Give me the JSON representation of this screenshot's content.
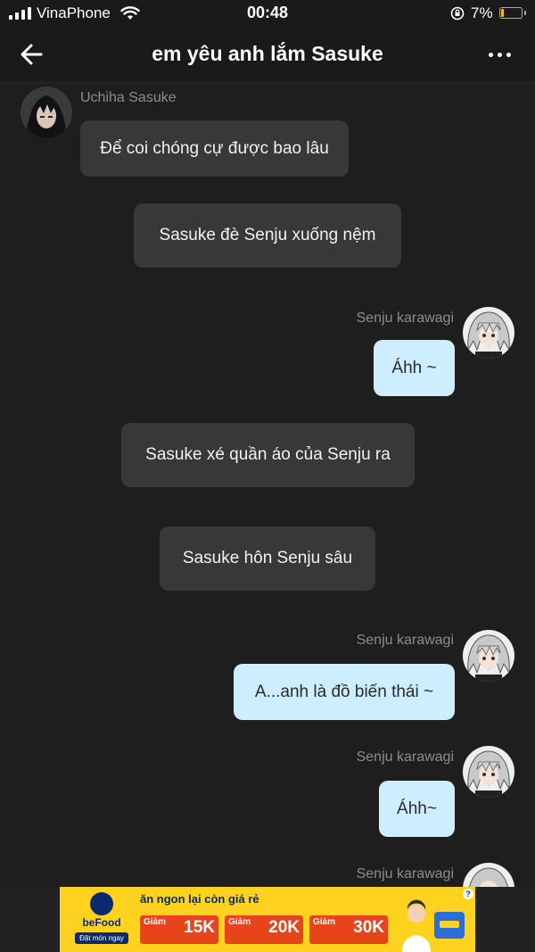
{
  "status_bar": {
    "carrier": "VinaPhone",
    "time": "00:48",
    "battery_percent": "7%"
  },
  "header": {
    "title": "em yêu anh lắm Sasuke",
    "back_icon": "arrow-left-icon",
    "more_icon": "more-dots-icon"
  },
  "messages": [
    {
      "type": "incoming",
      "sender": "Uchiha Sasuke",
      "text": "Để coi chóng cự được bao lâu"
    },
    {
      "type": "narration",
      "text": "Sasuke đè Senju xuống nệm"
    },
    {
      "type": "outgoing",
      "sender": "Senju karawagi",
      "text": "Áhh ~"
    },
    {
      "type": "narration",
      "text": "Sasuke xé quần áo của Senju ra"
    },
    {
      "type": "narration",
      "text": "Sasuke hôn Senju sâu"
    },
    {
      "type": "outgoing",
      "sender": "Senju karawagi",
      "text": "A...anh là đồ biến thái ~"
    },
    {
      "type": "outgoing",
      "sender": "Senju karawagi",
      "text": "Áhh~"
    },
    {
      "type": "outgoing",
      "sender": "Senju karawagi",
      "text": ""
    }
  ],
  "ad": {
    "brand": "beFood",
    "cta": "Đặt món ngay",
    "slogan": "ăn ngon lại còn giá rẻ",
    "coupons": [
      {
        "label": "Giảm",
        "amount": "15K"
      },
      {
        "label": "Giảm",
        "amount": "20K"
      },
      {
        "label": "Giảm",
        "amount": "30K"
      }
    ],
    "help": "?"
  },
  "colors": {
    "background": "#1e1e1e",
    "bubble_dark": "#383838",
    "bubble_blue": "#cdeefe",
    "ad_yellow": "#ffd21f",
    "ad_coupon": "#e8441c"
  }
}
